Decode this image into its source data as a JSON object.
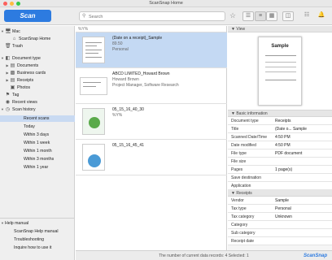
{
  "window": {
    "title": "ScanSnap Home"
  },
  "toolbar": {
    "scan_label": "Scan",
    "search_placeholder": "Search"
  },
  "sidebar": {
    "mac": "Mac",
    "home": "ScanSnap Home",
    "trash": "Trash",
    "doc_type": "Document type",
    "documents": "Documents",
    "business_cards": "Business cards",
    "receipts": "Receipts",
    "photos": "Photos",
    "tag": "Tag",
    "recent_views": "Recent views",
    "scan_history": "Scan history",
    "recent_scans": "Recent scans",
    "today": "Today",
    "within3": "Within 3 days",
    "within1w": "Within 1 week",
    "within1m": "Within 1 month",
    "within3m": "Within 3 months",
    "within1y": "Within 1 year",
    "help_manual": "Help manual",
    "help_sub": "ScanSnap Help manual",
    "troubleshooting": "Troubleshooting",
    "inquire": "Inquire how to use it"
  },
  "list": {
    "head": "%Y%",
    "items": [
      {
        "title": "(Date on a receipt)_Sample",
        "line2": "89.50",
        "line3": "Personal"
      },
      {
        "title": "ABCD LIMITED_Howard Brown",
        "line2": "Howard Brown",
        "line3": "Project Manager, Software Research"
      },
      {
        "title": "05_15_16_40_30",
        "line2": "%Y%"
      },
      {
        "title": "05_15_16_45_41",
        "line2": ""
      }
    ]
  },
  "status": {
    "text": "The number of current data records: 4  Selected: 1",
    "brand": "ScanSnap"
  },
  "panel": {
    "view": "View",
    "preview_title": "Sample",
    "basic": "Basic information",
    "basic_rows": [
      {
        "k": "Document type",
        "v": "Receipts"
      },
      {
        "k": "Title",
        "v": "(Date o... Sample"
      },
      {
        "k": "Scanned Date/Time",
        "v": "4:50 PM"
      },
      {
        "k": "Date modified",
        "v": "4:50 PM"
      },
      {
        "k": "File type",
        "v": "PDF document"
      },
      {
        "k": "File size",
        "v": ""
      },
      {
        "k": "Pages",
        "v": "1 page(s)"
      },
      {
        "k": "Save destination",
        "v": ""
      },
      {
        "k": "Application",
        "v": ""
      }
    ],
    "receipts": "Receipts",
    "receipt_rows": [
      {
        "k": "Vendor",
        "v": "Sample"
      },
      {
        "k": "Tax type",
        "v": "Personal"
      },
      {
        "k": "Tax category",
        "v": "Unknown"
      },
      {
        "k": "Category",
        "v": ""
      },
      {
        "k": "Sub category",
        "v": ""
      },
      {
        "k": "Receipt date",
        "v": ""
      }
    ]
  },
  "colors": {
    "accent": "#2d7be0",
    "selection": "#c4d9f3"
  }
}
